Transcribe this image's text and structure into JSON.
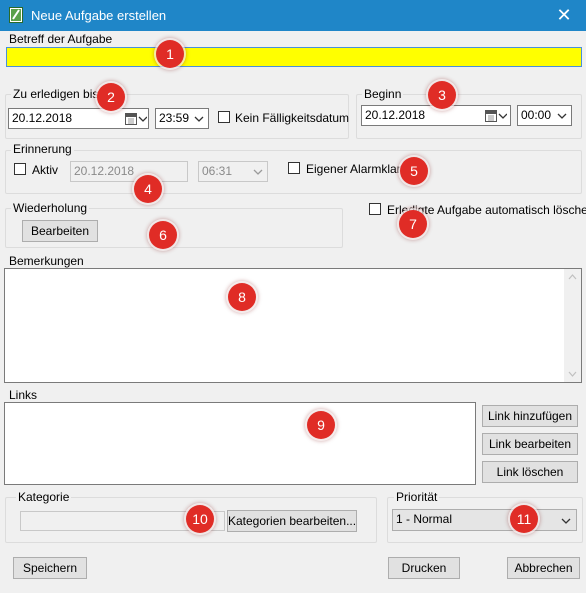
{
  "window": {
    "title": "Neue Aufgabe erstellen",
    "close_glyph": "✕",
    "icon": "edit-icon"
  },
  "subject": {
    "label": "Betreff der Aufgabe",
    "value": "",
    "bg_color": "#ffff00"
  },
  "due": {
    "group_label": "Zu erledigen bis...",
    "date": "20.12.2018",
    "time": "23:59",
    "no_due_label": "Kein Fälligkeitsdatum"
  },
  "start": {
    "group_label": "Beginn",
    "date": "20.12.2018",
    "time": "00:00"
  },
  "reminder": {
    "group_label": "Erinnerung",
    "active_label": "Aktiv",
    "date": "20.12.2018",
    "time": "06:31",
    "own_sound_label": "Eigener Alarmklang"
  },
  "recurrence": {
    "group_label": "Wiederholung",
    "edit_label": "Bearbeiten"
  },
  "auto_delete_label": "Erledigte Aufgabe automatisch löschen",
  "notes": {
    "label": "Bemerkungen",
    "value": ""
  },
  "links": {
    "label": "Links",
    "add_label": "Link hinzufügen",
    "edit_label": "Link bearbeiten",
    "delete_label": "Link löschen"
  },
  "category": {
    "group_label": "Kategorie",
    "value": "",
    "edit_label": "Kategorien bearbeiten..."
  },
  "priority": {
    "group_label": "Priorität",
    "value": "1 - Normal"
  },
  "footer": {
    "save_label": "Speichern",
    "print_label": "Drucken",
    "cancel_label": "Abbrechen"
  },
  "annotations": [
    "1",
    "2",
    "3",
    "4",
    "5",
    "6",
    "7",
    "8",
    "9",
    "10",
    "11"
  ],
  "colors": {
    "titlebar": "#1f86c8",
    "badge": "#e02c26"
  }
}
